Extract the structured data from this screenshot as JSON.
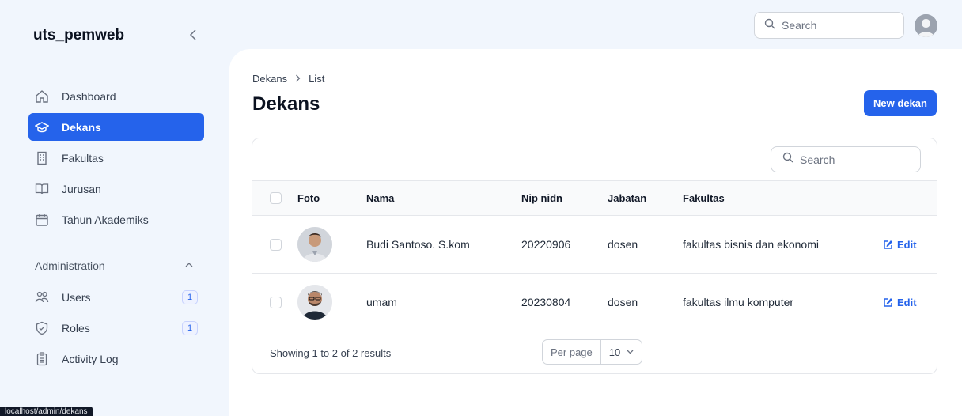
{
  "app": {
    "brand": "uts_pemweb"
  },
  "sidebar": {
    "items": [
      {
        "label": "Dashboard",
        "icon": "home-icon",
        "active": false
      },
      {
        "label": "Dekans",
        "icon": "graduation-cap-icon",
        "active": true
      },
      {
        "label": "Fakultas",
        "icon": "building-icon",
        "active": false
      },
      {
        "label": "Jurusan",
        "icon": "book-icon",
        "active": false
      },
      {
        "label": "Tahun Akademiks",
        "icon": "calendar-icon",
        "active": false
      }
    ],
    "group": {
      "label": "Administration"
    },
    "admin_items": [
      {
        "label": "Users",
        "icon": "users-icon",
        "badge": "1"
      },
      {
        "label": "Roles",
        "icon": "shield-check-icon",
        "badge": "1"
      },
      {
        "label": "Activity Log",
        "icon": "clipboard-icon",
        "badge": ""
      }
    ]
  },
  "topbar": {
    "search_placeholder": "Search"
  },
  "breadcrumb": {
    "parent": "Dekans",
    "current": "List"
  },
  "page": {
    "title": "Dekans",
    "new_button": "New dekan"
  },
  "table": {
    "search_placeholder": "Search",
    "columns": {
      "foto": "Foto",
      "nama": "Nama",
      "nip": "Nip nidn",
      "jabatan": "Jabatan",
      "fakultas": "Fakultas"
    },
    "rows": [
      {
        "nama": "Budi Santoso. S.kom",
        "nip": "20220906",
        "jabatan": "dosen",
        "fakultas": "fakultas bisnis dan ekonomi",
        "action": "Edit"
      },
      {
        "nama": "umam",
        "nip": "20230804",
        "jabatan": "dosen",
        "fakultas": "fakultas ilmu komputer",
        "action": "Edit"
      }
    ],
    "footer": {
      "summary": "Showing 1 to 2 of 2 results",
      "per_page_label": "Per page",
      "per_page_value": "10"
    }
  },
  "status_bar": {
    "url": "localhost/admin/dekans"
  },
  "colors": {
    "primary": "#2563eb",
    "background": "#f1f6fd"
  }
}
